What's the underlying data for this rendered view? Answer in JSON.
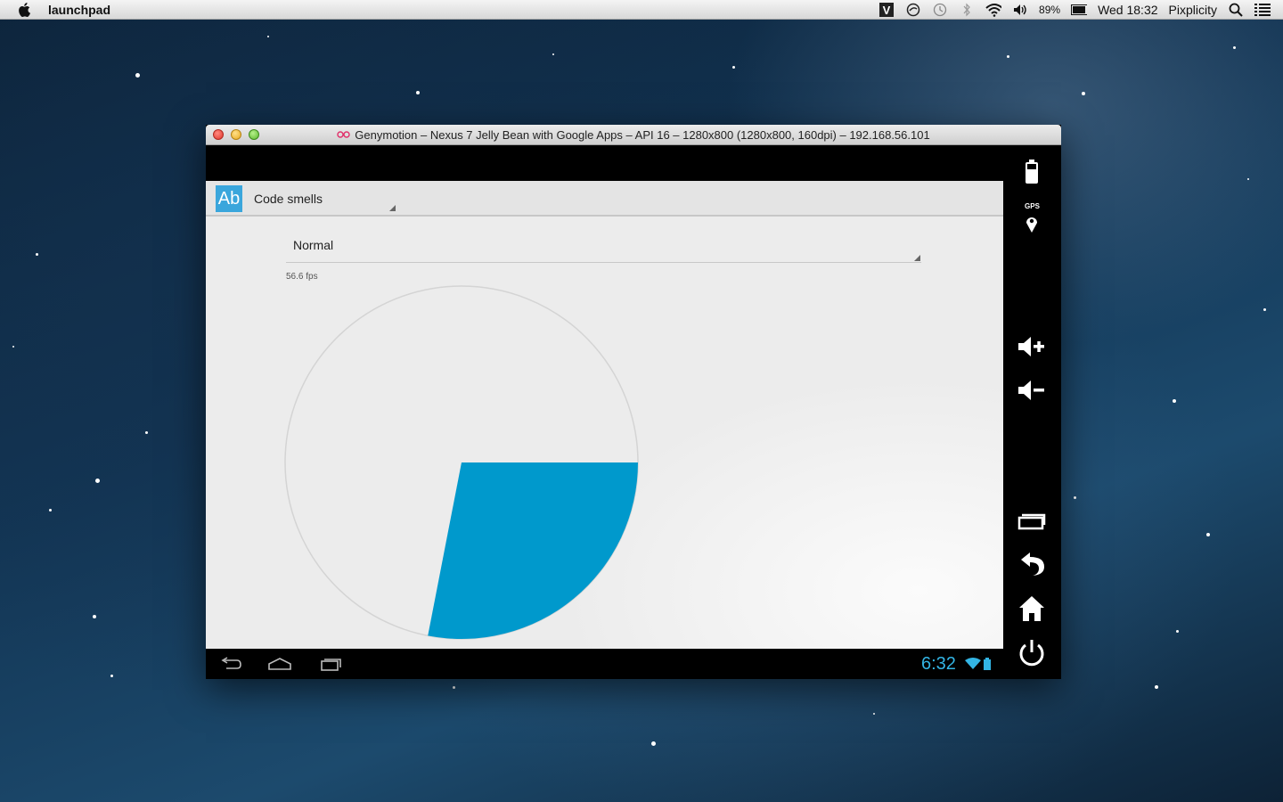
{
  "menubar": {
    "app_name": "launchpad",
    "battery_percent": "89%",
    "clock": "Wed 18:32",
    "user": "Pixplicity",
    "icons": [
      "apple-icon",
      "v-icon",
      "sync-icon",
      "time-machine-icon",
      "bluetooth-icon",
      "wifi-icon",
      "volume-icon",
      "battery-icon",
      "spotlight-icon",
      "notification-list-icon"
    ]
  },
  "window": {
    "title": "Genymotion – Nexus 7 Jelly Bean with Google Apps – API 16 – 1280x800 (1280x800, 160dpi) – 192.168.56.101"
  },
  "app": {
    "icon_text": "Ab",
    "spinner_title": "Code smells",
    "mode_spinner": "Normal",
    "fps": "56.6 fps",
    "pie": {
      "slice_color": "#0099cc",
      "start_angle_deg": 0,
      "sweep_deg": 101
    }
  },
  "android_nav": {
    "clock": "6:32",
    "clock_color": "#33b5e5",
    "buttons": [
      "back-icon",
      "home-icon",
      "recents-icon"
    ]
  },
  "genymotion_sidebar": {
    "gps_label": "GPS",
    "buttons": [
      "battery-button",
      "gps-button",
      "volume-up-button",
      "volume-down-button",
      "recents-button",
      "back-button",
      "home-button",
      "power-button"
    ]
  }
}
